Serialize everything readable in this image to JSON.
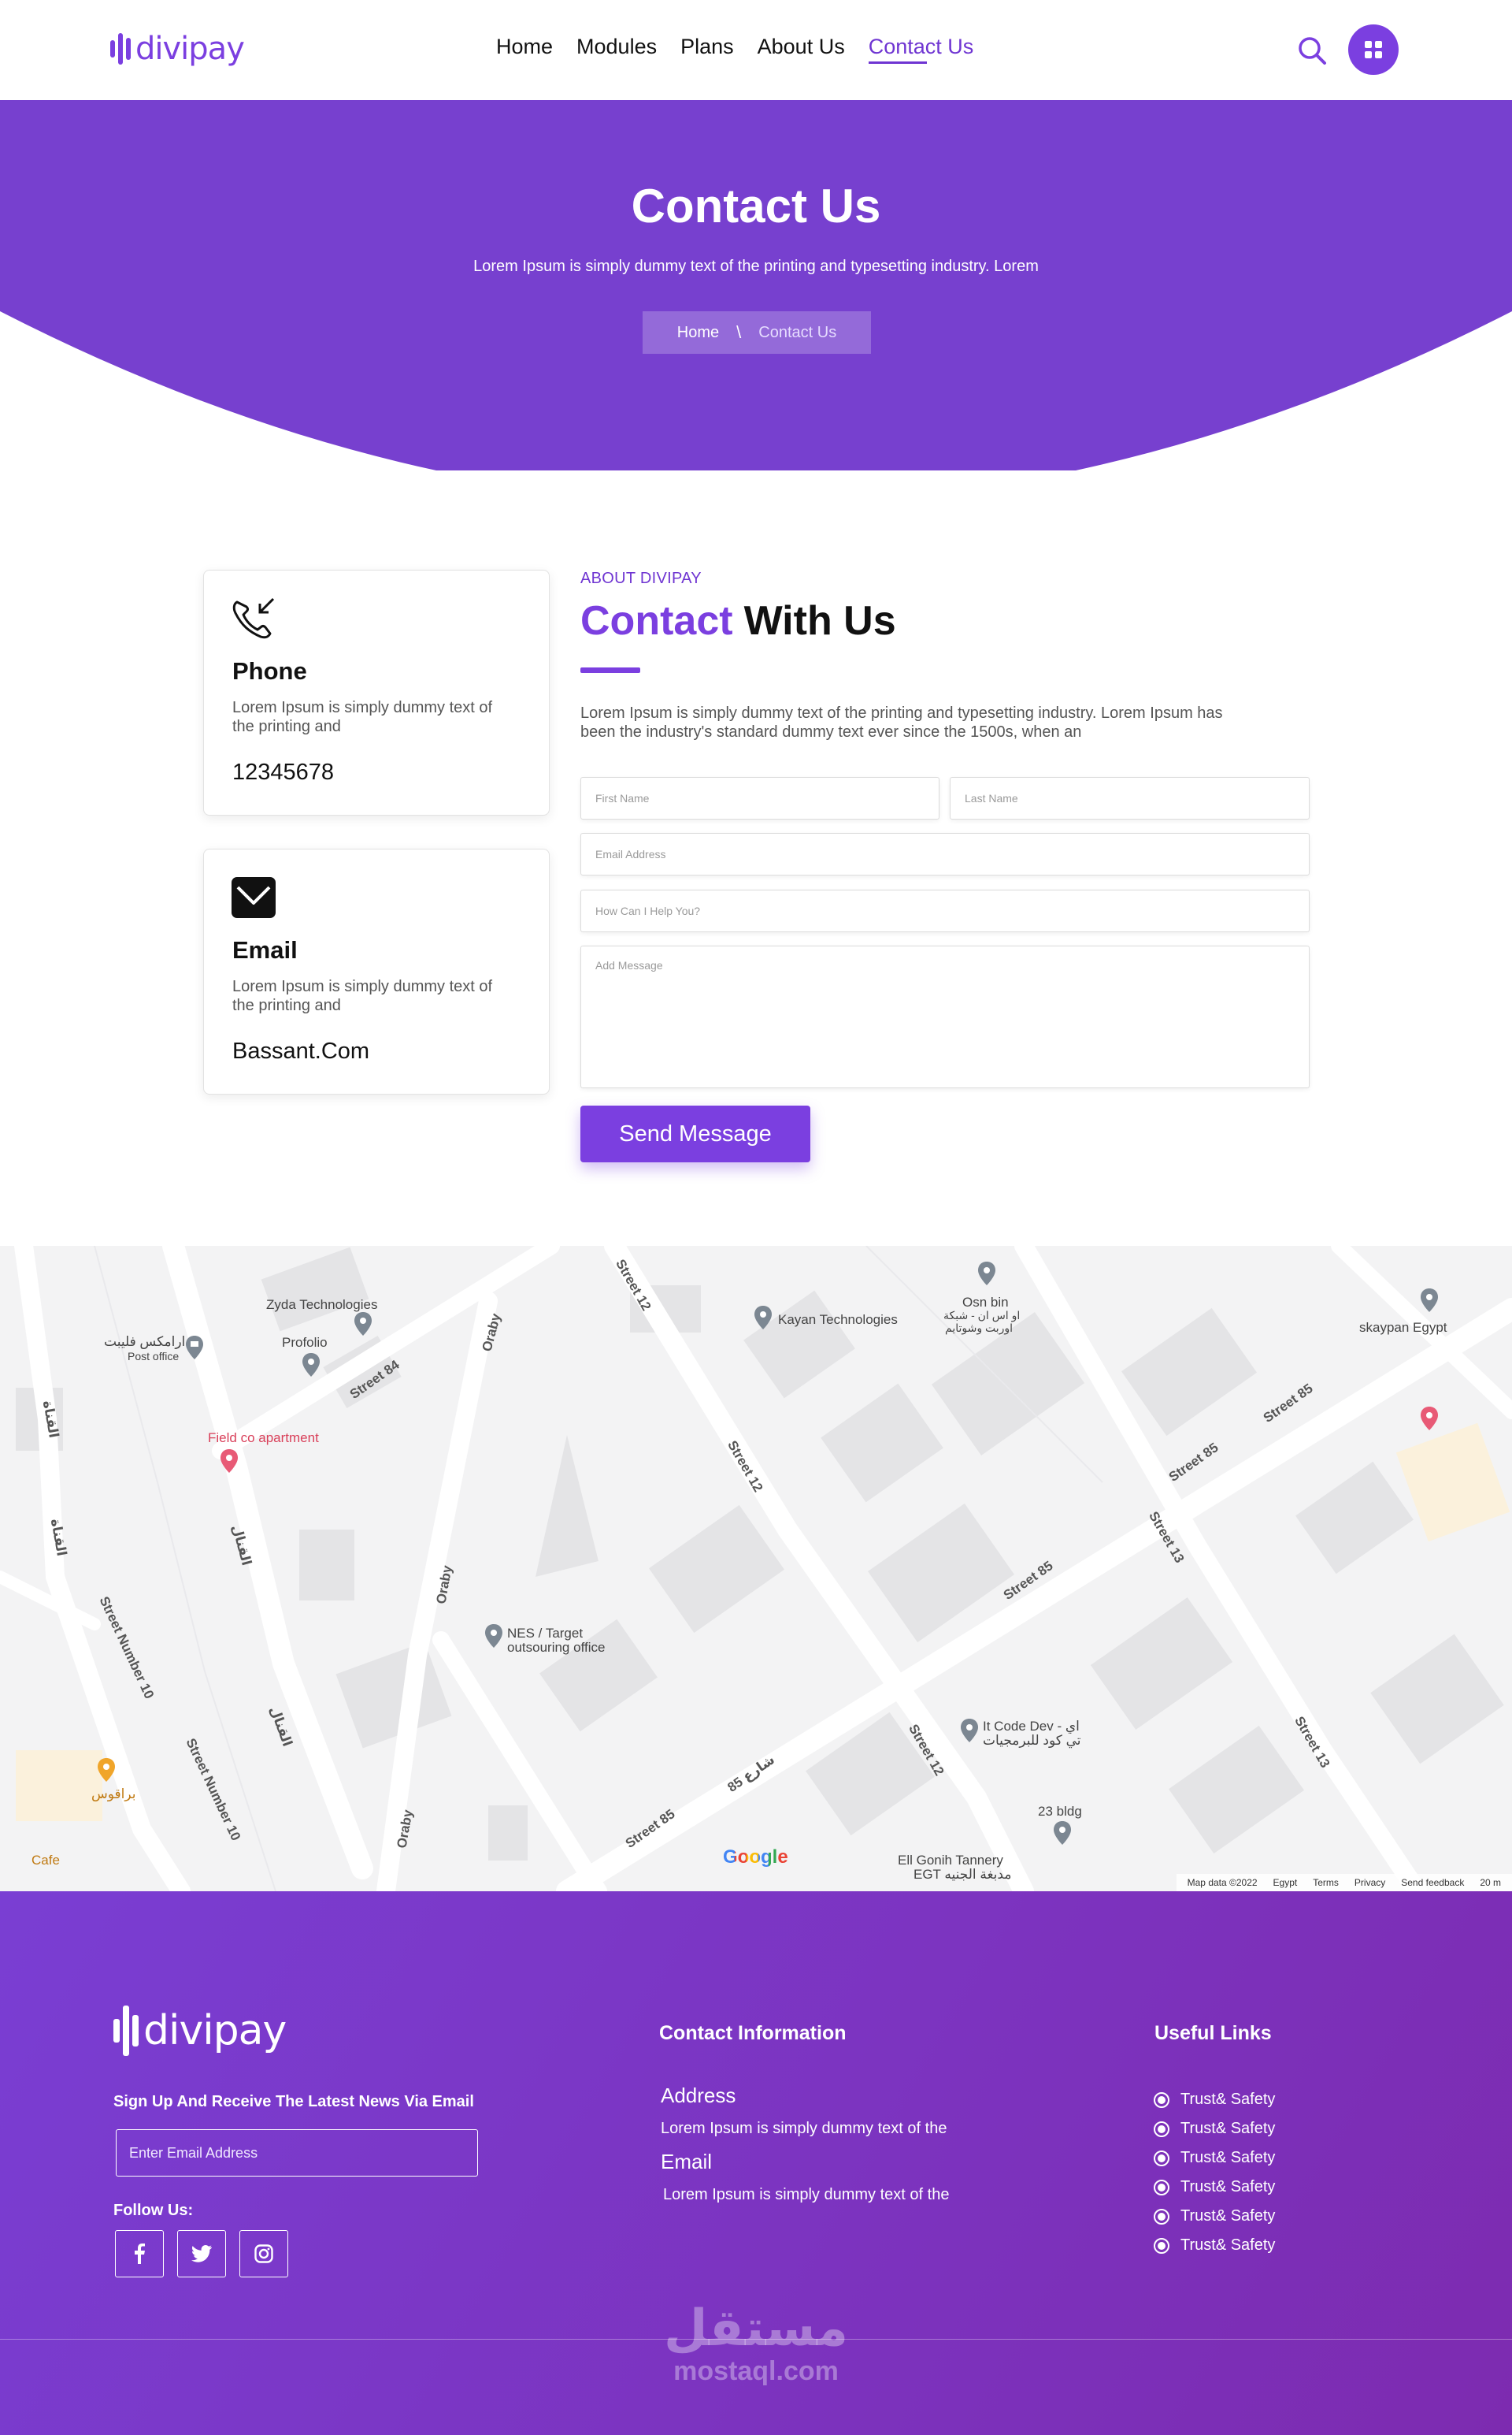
{
  "header": {
    "logo_text": "divipay",
    "nav": [
      "Home",
      "Modules",
      "Plans",
      "About Us",
      "Contact Us"
    ],
    "active_nav": "Contact Us"
  },
  "hero": {
    "title": "Contact Us",
    "subtitle": "Lorem Ipsum is simply dummy text of the printing and typesetting industry. Lorem",
    "breadcrumb_home": "Home",
    "breadcrumb_sep": "\\",
    "breadcrumb_current": "Contact Us"
  },
  "cards": [
    {
      "title": "Phone",
      "text": "Lorem Ipsum is simply dummy text of the printing and",
      "value": "12345678",
      "icon": "phone-icon"
    },
    {
      "title": "Email",
      "text": "Lorem Ipsum is simply dummy text of the printing and",
      "value": "Bassant.Com",
      "icon": "mail-icon"
    }
  ],
  "form": {
    "eyebrow": "ABOUT DIVIPAY",
    "title_accent": "Contact",
    "title_rest": "With Us",
    "description": "Lorem Ipsum is simply dummy text of the printing and typesetting industry. Lorem Ipsum has been the industry's standard dummy text ever since the 1500s, when an",
    "first_name_placeholder": "First Name",
    "last_name_placeholder": "Last Name",
    "email_placeholder": "Email Address",
    "help_placeholder": "How Can I Help You?",
    "message_placeholder": "Add Message",
    "send_label": "Send Message"
  },
  "map": {
    "places": [
      "Zyda Technologies",
      "Profolio",
      "ارامكس فليبت",
      "Post office",
      "Kayan Technologies",
      "Osn bin",
      "او اس ان - شبكة",
      "اوربت وشوتايم",
      "skaypan Egypt",
      "Field co apartment",
      "NES / Target",
      "outsouring office",
      "It Code Dev - اي",
      "تي كود للبرمجيات",
      "23 bldg",
      "Ell Gonih Tannery",
      "EGT مدبغة الجنيه",
      "براقوس",
      "Cafe"
    ],
    "streets": [
      "Street 12",
      "Street 84",
      "Oraby",
      "Street 85",
      "Street 13",
      "Street Number 10",
      "القناة",
      "القنال",
      "شارع 85"
    ],
    "google": "Google",
    "footer_items": [
      "Map data ©2022",
      "Egypt",
      "Terms",
      "Privacy",
      "Send feedback",
      "20 m"
    ]
  },
  "footer": {
    "logo_text": "divipay",
    "signup_text": "Sign Up And Receive The Latest News Via Email",
    "email_placeholder": "Enter Email Address",
    "follow_label": "Follow Us:",
    "contact_title": "Contact Information",
    "address_label": "Address",
    "address_text": "Lorem Ipsum is simply dummy text of the",
    "email_label": "Email",
    "email_text": "Lorem Ipsum is simply dummy text of the",
    "useful_title": "Useful Links",
    "useful_links": [
      "Trust& Safety",
      "Trust& Safety",
      "Trust& Safety",
      "Trust& Safety",
      "Trust& Safety",
      "Trust& Safety"
    ],
    "watermark_ar": "مستقل",
    "watermark_en": "mostaql.com"
  },
  "colors": {
    "brand": "#7b3fe0",
    "hero": "#7740cf",
    "footer_start": "#7a3ed3",
    "footer_end": "#7d2bb0"
  }
}
